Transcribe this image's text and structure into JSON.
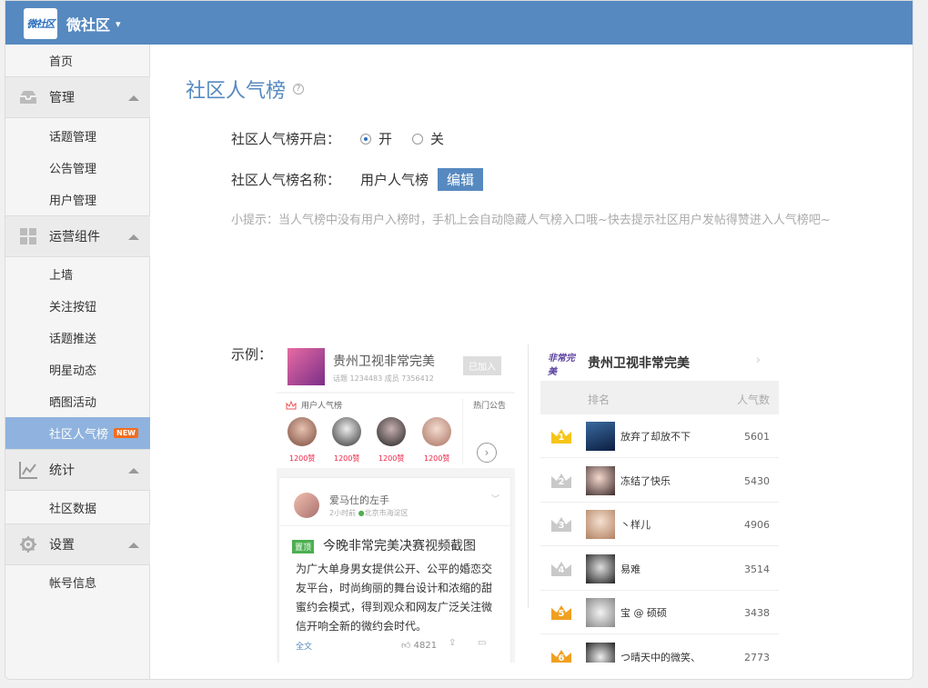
{
  "header": {
    "logo_text": "微社区",
    "brand": "微社区",
    "chevron": "▾"
  },
  "sidebar": {
    "home": "首页",
    "groups": [
      {
        "label": "管理",
        "icon": "inbox-icon",
        "items": [
          "话题管理",
          "公告管理",
          "用户管理"
        ]
      },
      {
        "label": "运营组件",
        "icon": "grid-icon",
        "items": [
          "上墙",
          "关注按钮",
          "话题推送",
          "明星动态",
          "晒图活动",
          "社区人气榜"
        ]
      },
      {
        "label": "统计",
        "icon": "chart-icon",
        "items": [
          "社区数据"
        ]
      },
      {
        "label": "设置",
        "icon": "gear-icon",
        "items": [
          "帐号信息"
        ]
      }
    ],
    "active_item": "社区人气榜",
    "new_badge": "NEW"
  },
  "main": {
    "title": "社区人气榜",
    "help": "?",
    "enable_label": "社区人气榜开启：",
    "option_on": "开",
    "option_off": "关",
    "enabled": true,
    "name_label": "社区人气榜名称：",
    "name_value": "用户人气榜",
    "edit_button": "编辑",
    "tip": "小提示：当人气榜中没有用户入榜时，手机上会自动隐藏人气榜入口哦~快去提示社区用户发帖得赞进入人气榜吧~",
    "example_label": "示例："
  },
  "phone_a": {
    "community_name": "贵州卫视非常完美",
    "stats": "话题 1234483   成员 7356412",
    "join_button": "已加入",
    "rank_title": "用户人气榜",
    "hot_notice": "热门公告",
    "rank_likes": [
      "1200赞",
      "1200赞",
      "1200赞",
      "1200赞"
    ],
    "more": "›",
    "post": {
      "author": "爱马仕的左手",
      "time": "2小时前",
      "location": "北京市海淀区",
      "tag": "置顶",
      "title": "今晚非常完美决赛视频截图",
      "body": "为广大单身男女提供公开、公平的婚恋交友平台，时尚绚丽的舞台设计和浓缩的甜蜜约会模式，得到观众和网友广泛关注微信开响全新的微约会时代。",
      "full_text": "全文",
      "likes": "4821"
    }
  },
  "phone_b": {
    "logo_text": "非常完美",
    "community_name": "贵州卫视非常完美",
    "col_rank": "排名",
    "col_pop": "人气数",
    "rows": [
      {
        "rank": "1",
        "name": "放弃了却放不下",
        "score": "5601",
        "crown_color": "#f5c518"
      },
      {
        "rank": "2",
        "name": "冻结了快乐",
        "score": "5430",
        "crown_color": "#c9c9c9"
      },
      {
        "rank": "3",
        "name": "丶样儿",
        "score": "4906",
        "crown_color": "#c9c9c9"
      },
      {
        "rank": "4",
        "name": "易难",
        "score": "3514",
        "crown_color": "#c9c9c9"
      },
      {
        "rank": "5",
        "name": "宝 @ 硕硕",
        "score": "3438",
        "crown_color": "#f0a020"
      },
      {
        "rank": "6",
        "name": "つ晴天中的微笑、",
        "score": "2773",
        "crown_color": "#f0a020"
      }
    ]
  }
}
